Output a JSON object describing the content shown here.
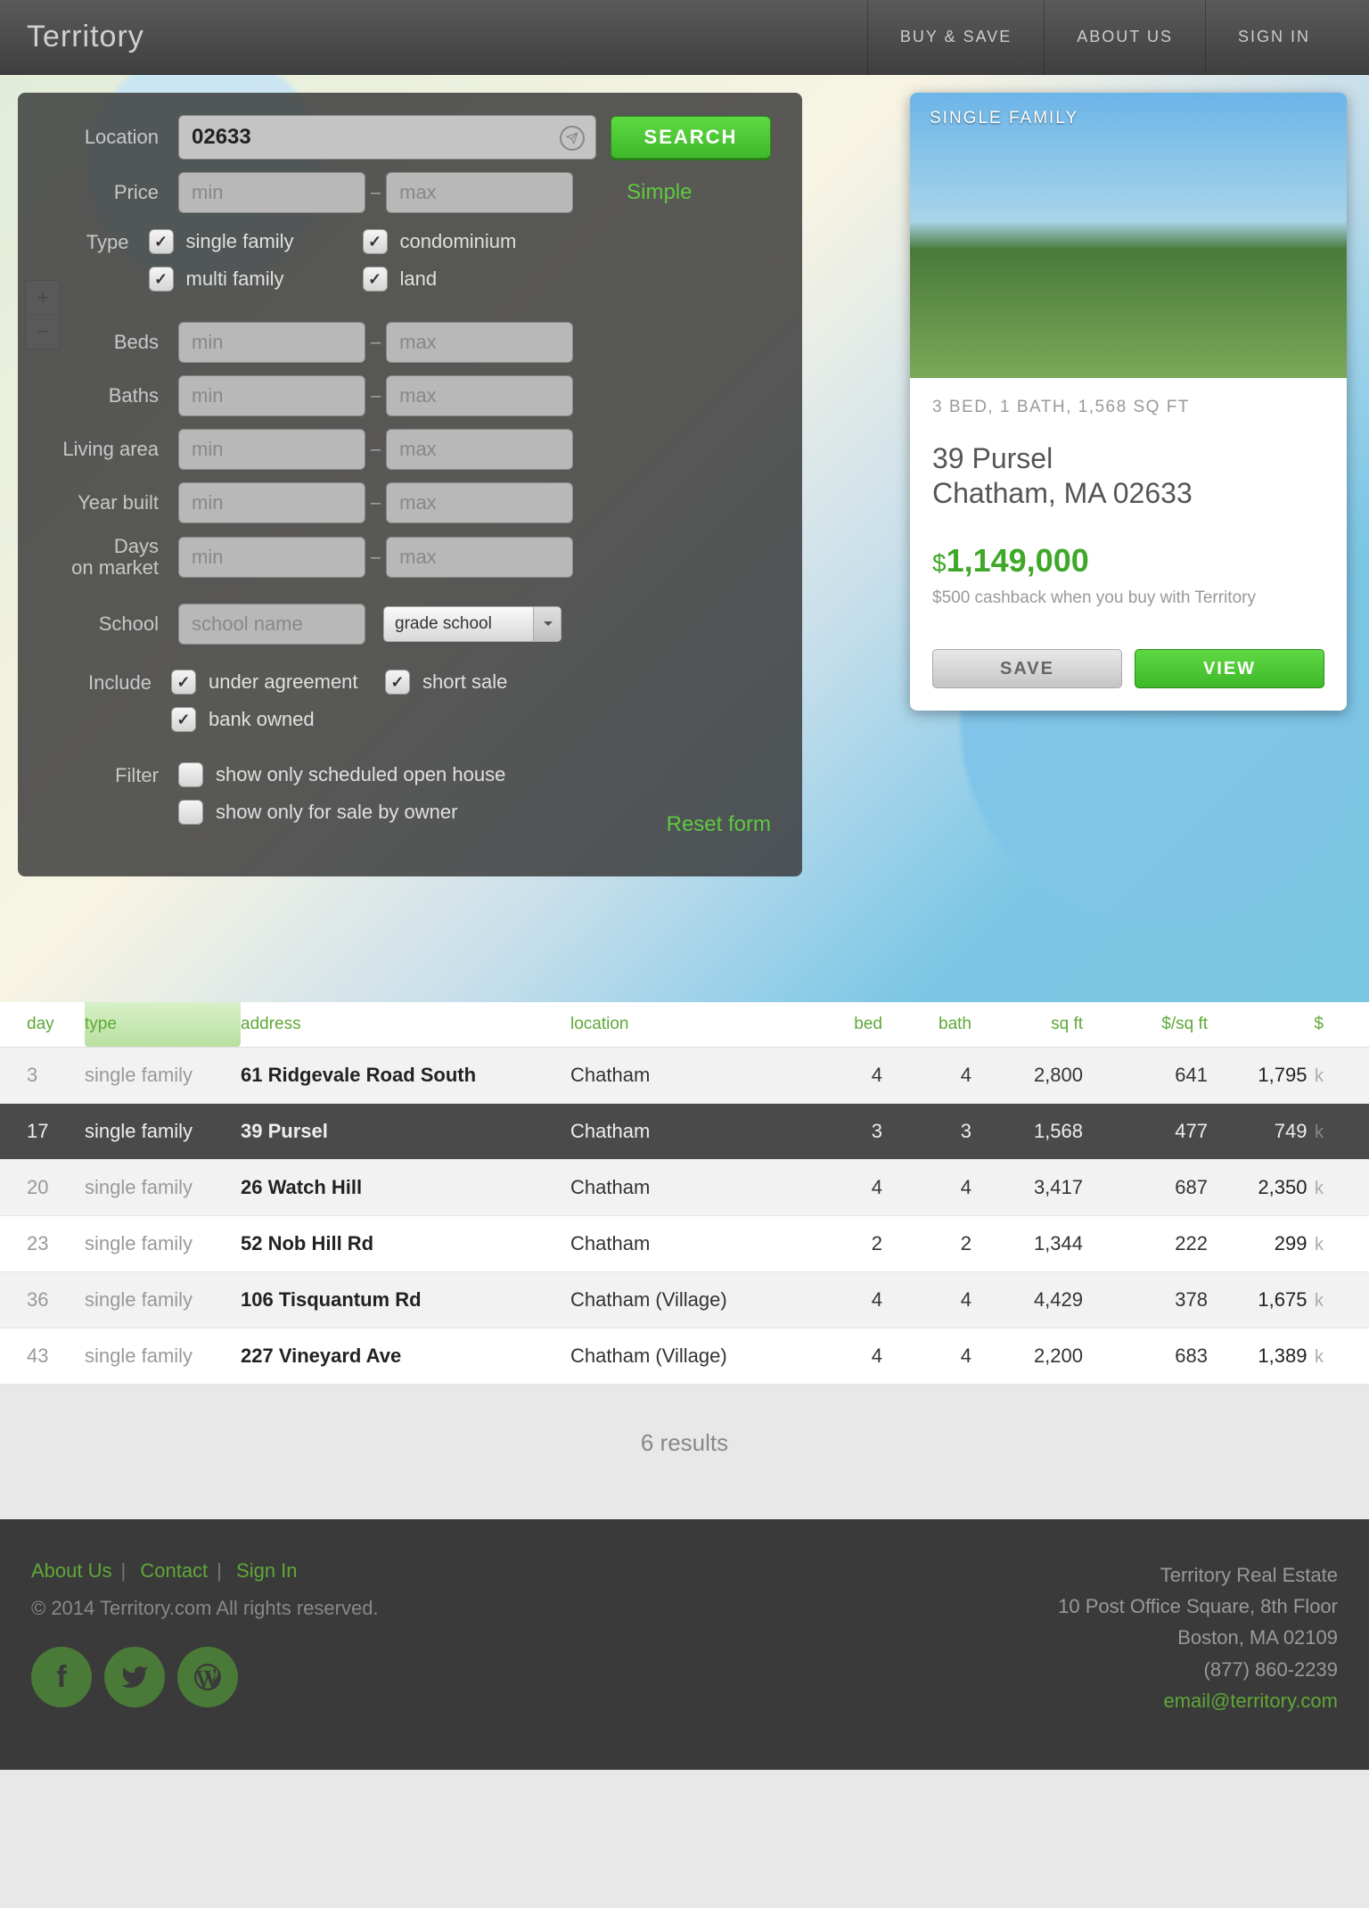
{
  "header": {
    "logo": "Territory",
    "nav": [
      "BUY & SAVE",
      "ABOUT US",
      "SIGN IN"
    ]
  },
  "search": {
    "location_label": "Location",
    "location_value": "02633",
    "search_btn": "SEARCH",
    "price_label": "Price",
    "min_ph": "min",
    "max_ph": "max",
    "simple_link": "Simple",
    "type_label": "Type",
    "types": [
      {
        "label": "single family",
        "checked": true
      },
      {
        "label": "condominium",
        "checked": true
      },
      {
        "label": "multi family",
        "checked": true
      },
      {
        "label": "land",
        "checked": true
      }
    ],
    "beds_label": "Beds",
    "baths_label": "Baths",
    "living_label": "Living area",
    "year_label": "Year built",
    "days_label1": "Days",
    "days_label2": "on market",
    "school_label": "School",
    "school_ph": "school name",
    "school_select": "grade school",
    "include_label": "Include",
    "includes": [
      {
        "label": "under agreement",
        "checked": true
      },
      {
        "label": "short sale",
        "checked": true
      },
      {
        "label": "bank owned",
        "checked": true
      }
    ],
    "filter_label": "Filter",
    "filters": [
      {
        "label": "show only scheduled open house",
        "checked": false
      },
      {
        "label": "show only for sale by owner",
        "checked": false
      }
    ],
    "reset_link": "Reset form"
  },
  "card": {
    "img_label": "SINGLE FAMILY",
    "specs": "3 BED, 1 BATH, 1,568 SQ FT",
    "addr1": "39 Pursel",
    "addr2": "Chatham, MA 02633",
    "price": "1,149,000",
    "cashback": "$500 cashback when you buy with Territory",
    "save_btn": "SAVE",
    "view_btn": "VIEW"
  },
  "table": {
    "headers": {
      "day": "day",
      "type": "type",
      "addr": "address",
      "loc": "location",
      "bed": "bed",
      "bath": "bath",
      "sqft": "sq ft",
      "psqft": "$/sq ft",
      "price": "$"
    },
    "rows": [
      {
        "day": "3",
        "type": "single family",
        "addr": "61 Ridgevale Road South",
        "loc": "Chatham",
        "bed": "4",
        "bath": "4",
        "sqft": "2,800",
        "psqft": "641",
        "price": "1,795",
        "selected": false
      },
      {
        "day": "17",
        "type": "single family",
        "addr": "39 Pursel",
        "loc": "Chatham",
        "bed": "3",
        "bath": "3",
        "sqft": "1,568",
        "psqft": "477",
        "price": "749",
        "selected": true
      },
      {
        "day": "20",
        "type": "single family",
        "addr": "26 Watch Hill",
        "loc": "Chatham",
        "bed": "4",
        "bath": "4",
        "sqft": "3,417",
        "psqft": "687",
        "price": "2,350",
        "selected": false
      },
      {
        "day": "23",
        "type": "single family",
        "addr": "52 Nob Hill Rd",
        "loc": "Chatham",
        "bed": "2",
        "bath": "2",
        "sqft": "1,344",
        "psqft": "222",
        "price": "299",
        "selected": false
      },
      {
        "day": "36",
        "type": "single family",
        "addr": "106 Tisquantum Rd",
        "loc": "Chatham (Village)",
        "bed": "4",
        "bath": "4",
        "sqft": "4,429",
        "psqft": "378",
        "price": "1,675",
        "selected": false
      },
      {
        "day": "43",
        "type": "single family",
        "addr": "227 Vineyard Ave",
        "loc": "Chatham (Village)",
        "bed": "4",
        "bath": "4",
        "sqft": "2,200",
        "psqft": "683",
        "price": "1,389",
        "selected": false
      }
    ],
    "count": "6 results"
  },
  "footer": {
    "links": [
      "About Us",
      "Contact",
      "Sign In"
    ],
    "copyright": "© 2014 Territory.com All rights reserved.",
    "company": "Territory Real Estate",
    "addr1": "10 Post Office Square, 8th Floor",
    "addr2": "Boston, MA 02109",
    "phone": "(877) 860-2239",
    "email": "email@territory.com"
  }
}
